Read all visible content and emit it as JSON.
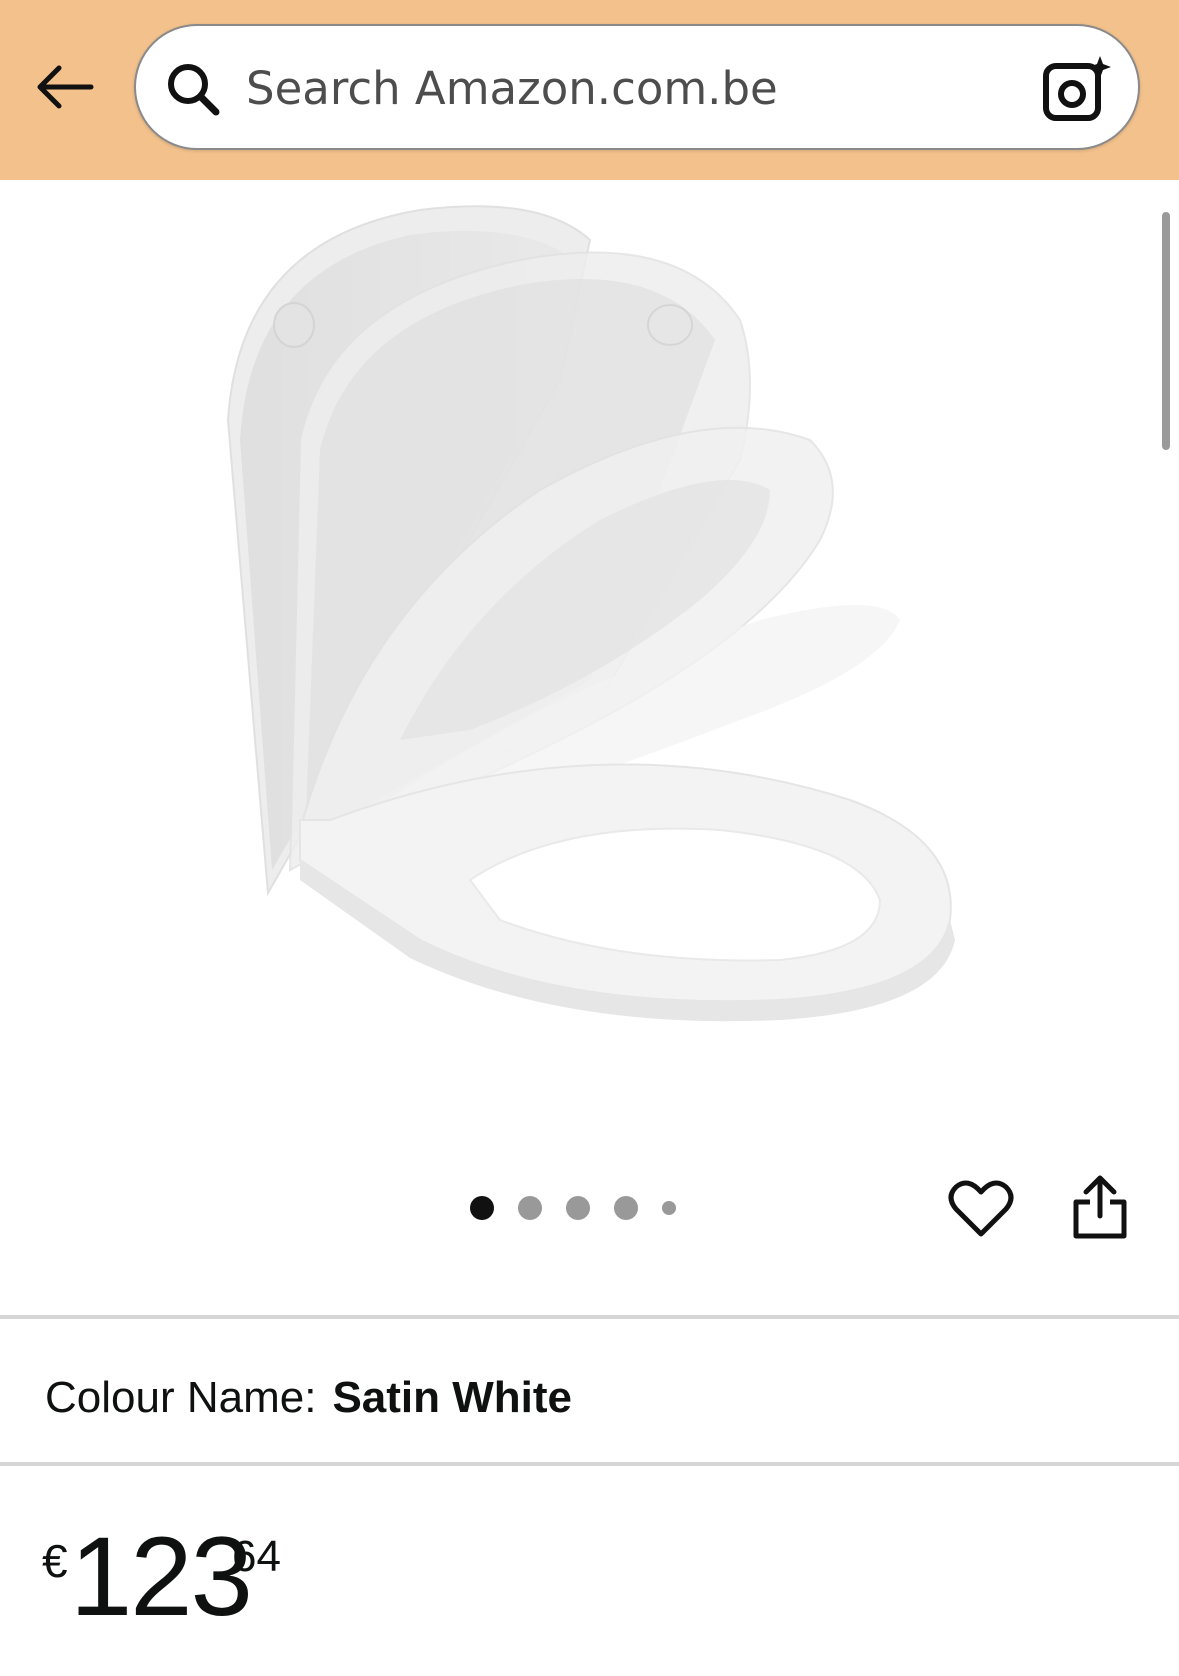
{
  "header": {
    "background_color": "#f2c18c",
    "back_icon": "arrow-left-icon",
    "search": {
      "placeholder": "Search Amazon.com.be",
      "value": "",
      "icon": "search-icon",
      "camera_icon": "camera-sparkle-icon"
    }
  },
  "product": {
    "image_description_icon": "toilet-seat-product-image",
    "carousel": {
      "total_dots": 5,
      "active_index": 0
    },
    "actions": {
      "wishlist_icon": "heart-icon",
      "share_icon": "share-icon"
    },
    "colour": {
      "label": "Colour Name:",
      "value": "Satin White"
    },
    "price": {
      "symbol": "€",
      "whole": "123",
      "fraction": "64"
    }
  }
}
